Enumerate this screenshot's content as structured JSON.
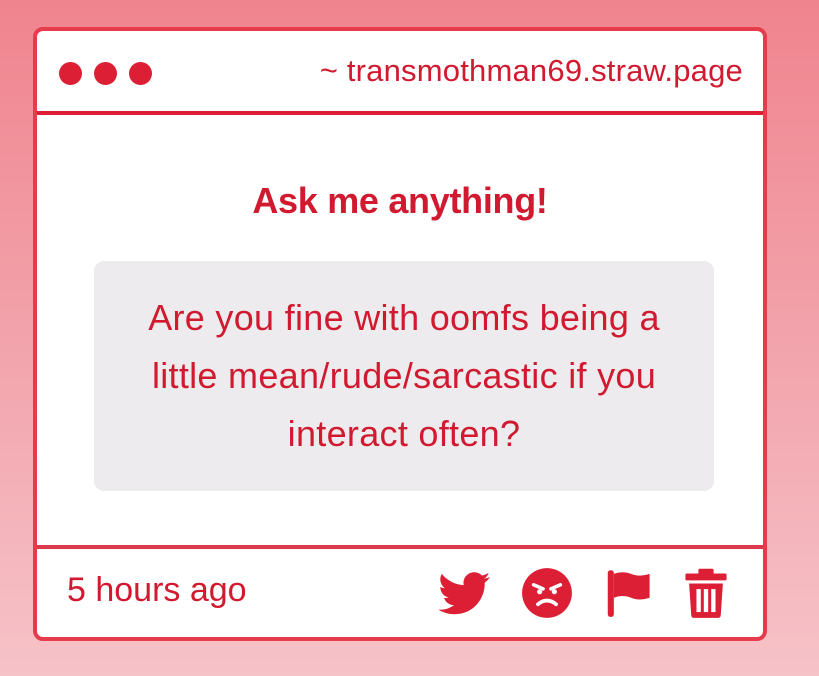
{
  "window": {
    "url": "~ transmothman69.straw.page"
  },
  "main": {
    "heading": "Ask me anything!",
    "question": "Are you fine with oomfs being a little mean/rude/sarcastic if you interact often?"
  },
  "footer": {
    "timestamp": "5 hours ago",
    "actions": [
      {
        "icon": "twitter-icon"
      },
      {
        "icon": "angry-face-icon"
      },
      {
        "icon": "flag-icon"
      },
      {
        "icon": "trash-icon"
      }
    ]
  },
  "colors": {
    "accent": "#dc1f35",
    "border": "#e63b4b",
    "question_bg": "#edebed",
    "background_top": "#f0848e",
    "background_bottom": "#f6c3c8"
  }
}
